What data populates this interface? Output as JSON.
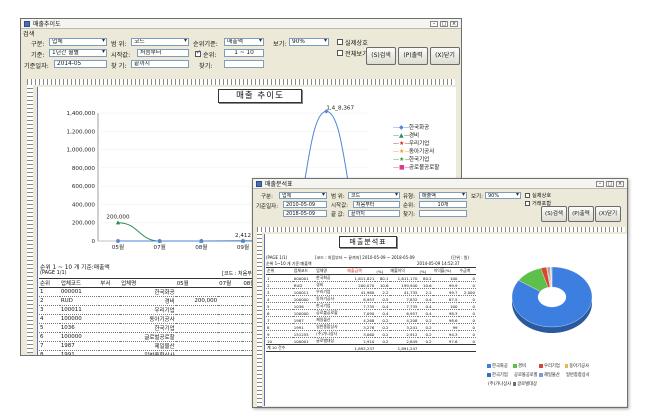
{
  "w1": {
    "title": "매출추이도",
    "section": "검색",
    "labels": {
      "category": "구분:",
      "period": "기준:",
      "basis_date": "기준일자:",
      "range": "범 위:",
      "start_pos": "시작값:",
      "search": "찾 기:",
      "order": "순위기준:",
      "rank_chk": "순위:",
      "find": "찾기:",
      "view": "보기:",
      "real_biz": "실제상호",
      "all_view": "전체보기"
    },
    "values": {
      "category": "업체",
      "period": "1년간 월별",
      "basis_date": "2014-05",
      "range": "코드",
      "start_pos": "처음부터",
      "search": "끝까지",
      "order": "매출액",
      "rank": "1 ~ 10",
      "view": "90%"
    },
    "buttons": {
      "search": "(S)검색",
      "print": "(P)출력",
      "close": "(X)닫기"
    },
    "report_title": "매출 추이도",
    "peak_label": "1,4_8,367",
    "table_caption": "순위 1 ~ 10 개   기준:매출액",
    "page": "(PAGE 1/1)",
    "range_note": "[코드 : 처음부터 ~ 끝까",
    "headers": [
      "순위",
      "업체코드",
      "부서",
      "업체명",
      "05월",
      "07월",
      "08월",
      "09월"
    ],
    "rows": [
      [
        "1",
        "000001",
        "",
        "한국화공",
        "",
        "",
        "",
        ""
      ],
      [
        "2",
        "RUD",
        "",
        "경비",
        "200,000",
        "",
        "70",
        "0"
      ],
      [
        "3",
        "100011",
        "",
        "우리기업",
        "",
        "",
        "",
        "0"
      ],
      [
        "4",
        "100000",
        "",
        "동아기공사",
        "",
        "",
        "",
        "0"
      ],
      [
        "5",
        "1036",
        "",
        "한국기업",
        "",
        "",
        "",
        "0"
      ],
      [
        "6",
        "100000",
        "",
        "글로벌공로할",
        "",
        "",
        "",
        "0"
      ],
      [
        "7",
        "1987",
        "",
        "제일물산",
        "",
        "",
        "",
        "0"
      ],
      [
        "8",
        "1991",
        "",
        "일반종합상사",
        "",
        "",
        "",
        "0"
      ],
      [
        "9",
        "151255",
        "",
        "(주)가나상사",
        "99",
        "84",
        "0",
        "2,117"
      ],
      [
        "10",
        "100001",
        "",
        "글로벌대상",
        "72",
        "0",
        "",
        "2,117"
      ]
    ]
  },
  "w2": {
    "title": "매출분석표",
    "labels": {
      "category": "구분:",
      "basis_date": "기준일자:",
      "range": "범 위:",
      "start_pos": "시작값:",
      "search": "끝 값:",
      "type": "유형:",
      "order": "순위:",
      "find": "찾기:",
      "view": "보기:",
      "real_biz": "실제상호",
      "all_view": "거래포함"
    },
    "values": {
      "category": "업체",
      "date_from": "2010-05-09",
      "date_to": "2018-05-09",
      "range": "코드",
      "start_pos": "처음부터",
      "search": "끝까지",
      "type": "매출액",
      "order": "10개",
      "view": "90%"
    },
    "buttons": {
      "search": "(S)검색",
      "print": "(P)출력",
      "close": "(X)닫기"
    },
    "report_title": "매출분석표",
    "page": "(PAGE 1/1)",
    "header_info": "[코드 : 처음부터 ~ 끝까지] 2010-05-09 ~ 2018-05-09",
    "unit_note": "(단위 : 원)",
    "caption": "순위 1~10 개   기준:매출액",
    "print_date": "2014-05-09 14:52:37",
    "headers": [
      "순위",
      "업체코드",
      "업체명",
      "매출금액",
      "(%)",
      "매출이익",
      "(%)",
      "이익율(%)",
      "수금액"
    ],
    "rows": [
      [
        "1",
        "000001",
        "한국화공",
        "1,611,821",
        "80.1",
        "1,611,170",
        "80.2",
        "100",
        "0"
      ],
      [
        "2",
        "RUD",
        "경비",
        "200,070",
        "10.6",
        "199,940",
        "10.6",
        "99.9",
        "0"
      ],
      [
        "3",
        "100011",
        "우리기업",
        "41,980",
        "2.2",
        "41,735",
        "2.2",
        "99.7",
        "2,000"
      ],
      [
        "4",
        "100000",
        "동아기공사",
        "8,953",
        "0.5",
        "7,832",
        "0.4",
        "87.5",
        "0"
      ],
      [
        "5",
        "1036",
        "한국기업",
        "7,735",
        "0.4",
        "7,735",
        "0.4",
        "100",
        "0"
      ],
      [
        "6",
        "100000",
        "공로볼공로할",
        "7,090",
        "0.4",
        "6,957",
        "0.4",
        "98.3",
        "0"
      ],
      [
        "7",
        "1987",
        "제일물산",
        "4,268",
        "0.2",
        "4,208",
        "0.2",
        "98.6",
        "0"
      ],
      [
        "8",
        "1991",
        "일반종합상사",
        "3,276",
        "0.2",
        "3,241",
        "0.2",
        "99",
        "0"
      ],
      [
        "9",
        "151255",
        "(주)가나상사",
        "3,060",
        "0.2",
        "2,912",
        "0.2",
        "94.3",
        "0"
      ],
      [
        "10",
        "100001",
        "글로벌대상",
        "2,910",
        "0.2",
        "2,849",
        "0.2",
        "97.6",
        "0"
      ]
    ],
    "total_label": "계  10 건수",
    "total_sales": "1,893,237",
    "total_profit": "1,891,247"
  },
  "chart_data": [
    {
      "type": "line",
      "title": "매출 추이도",
      "x": [
        "05월",
        "07월",
        "08월",
        "09월",
        "10월",
        "11월",
        "12월"
      ],
      "ylim": [
        0,
        1400000
      ],
      "yticks": [
        "0",
        "200,000",
        "400,000",
        "600,000",
        "800,000",
        "1,000,000",
        "1,200,000",
        "1,400,000"
      ],
      "series": [
        {
          "name": "한국화공",
          "color": "#4e86d6",
          "marker": "diamond",
          "values": [
            0,
            0,
            0,
            0,
            0,
            1418367,
            0
          ]
        },
        {
          "name": "경비",
          "color": "#2e8b57",
          "marker": "triangle",
          "values": [
            200000,
            0,
            0,
            2412,
            0,
            0,
            0
          ]
        },
        {
          "name": "우리기업",
          "color": "#cc2a2a",
          "marker": "star",
          "values": [
            0,
            0,
            0,
            0,
            0,
            0,
            0
          ]
        },
        {
          "name": "동아기공사",
          "color": "#e3a21a",
          "marker": "star",
          "values": [
            0,
            0,
            0,
            0,
            0,
            0,
            0
          ]
        },
        {
          "name": "한국기업",
          "color": "#3a9a3a",
          "marker": "star",
          "values": [
            0,
            0,
            0,
            0,
            0,
            0,
            0
          ]
        },
        {
          "name": "공로볼공로할",
          "color": "#d43f8d",
          "marker": "square",
          "values": [
            0,
            0,
            0,
            0,
            0,
            0,
            0
          ]
        }
      ],
      "point_labels": [
        "200,000",
        "2,412",
        "1,4_8,367"
      ]
    },
    {
      "type": "pie",
      "style": "donut",
      "series": [
        {
          "name": "한국화공",
          "color": "#3d7fe0",
          "value": 80.1
        },
        {
          "name": "경비",
          "color": "#5fbf4b",
          "value": 10.6
        },
        {
          "name": "우리기업",
          "color": "#d84436",
          "value": 2.2
        },
        {
          "name": "동아기공사",
          "color": "#e8b84a",
          "value": 0.5
        },
        {
          "name": "한국기업",
          "color": "#2f6fbf",
          "value": 0.4
        },
        {
          "name": "공로볼공로할",
          "color": "#c9498f",
          "value": 0.4
        },
        {
          "name": "제일물산",
          "color": "#7a9ad8",
          "value": 0.2
        },
        {
          "name": "일반종합상사",
          "color": "#8ad16a",
          "value": 0.2
        },
        {
          "name": "(주)가나상사",
          "color": "#f0d060",
          "value": 0.2
        },
        {
          "name": "글로벌대상",
          "color": "#6e6e6e",
          "value": 0.2
        }
      ]
    }
  ]
}
